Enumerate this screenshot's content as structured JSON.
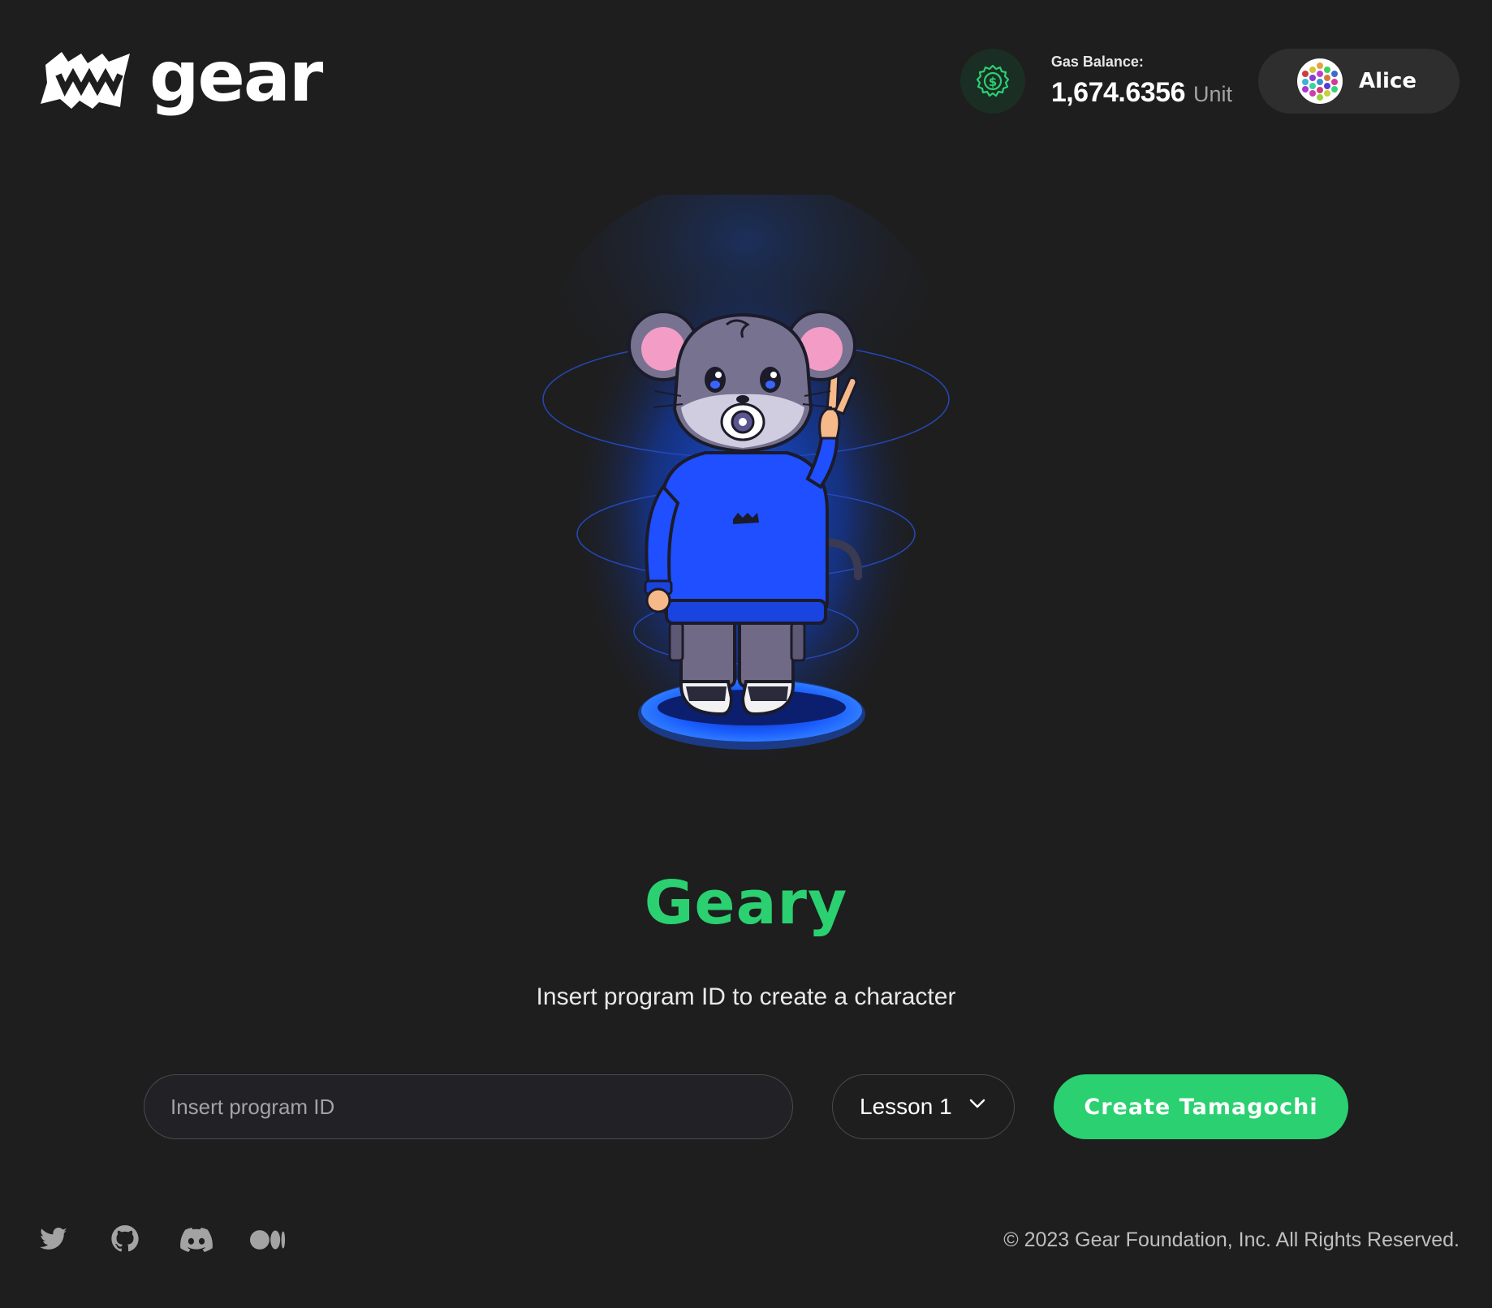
{
  "header": {
    "logo_text": "gear",
    "gas_balance_label": "Gas Balance:",
    "gas_balance_value": "1,674.6356",
    "gas_balance_unit": "Unit",
    "account_name": "Alice"
  },
  "hero": {
    "character_name": "Geary",
    "subtitle": "Insert program ID to create a character"
  },
  "form": {
    "program_id_placeholder": "Insert program ID",
    "program_id_value": "",
    "lesson_selected": "Lesson 1",
    "create_label": "Create Tamagochi"
  },
  "footer": {
    "social_icons": [
      "twitter-icon",
      "github-icon",
      "discord-icon",
      "medium-icon"
    ],
    "copyright": "© 2023 Gear Foundation, Inc. All Rights Reserved."
  },
  "colors": {
    "background": "#1e1e1e",
    "accent_green": "#2bd071",
    "glow_blue": "#1a5cff"
  }
}
